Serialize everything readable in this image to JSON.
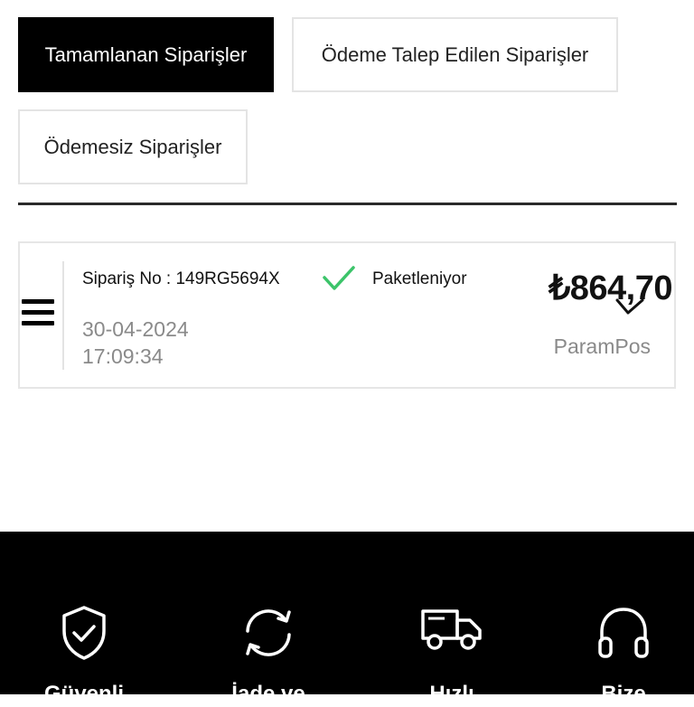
{
  "tabs": [
    {
      "label": "Tamamlanan Siparişler",
      "active": true
    },
    {
      "label": "Ödeme Talep Edilen Siparişler",
      "active": false
    },
    {
      "label": "Ödemesiz Siparişler",
      "active": false
    }
  ],
  "order": {
    "number_label": "Sipariş No : 149RG5694X",
    "date": "30-04-2024",
    "time": "17:09:34",
    "status": "Paketleniyor",
    "status_color": "#3cc46a",
    "price": "₺864,70",
    "payment_method": "ParamPos"
  },
  "footer": {
    "features": [
      {
        "icon": "shield-check-icon",
        "label": "Güvenli"
      },
      {
        "icon": "refresh-icon",
        "label": "İade ve"
      },
      {
        "icon": "truck-icon",
        "label": "Hızlı"
      },
      {
        "icon": "headphones-icon",
        "label": "Bize"
      }
    ]
  }
}
